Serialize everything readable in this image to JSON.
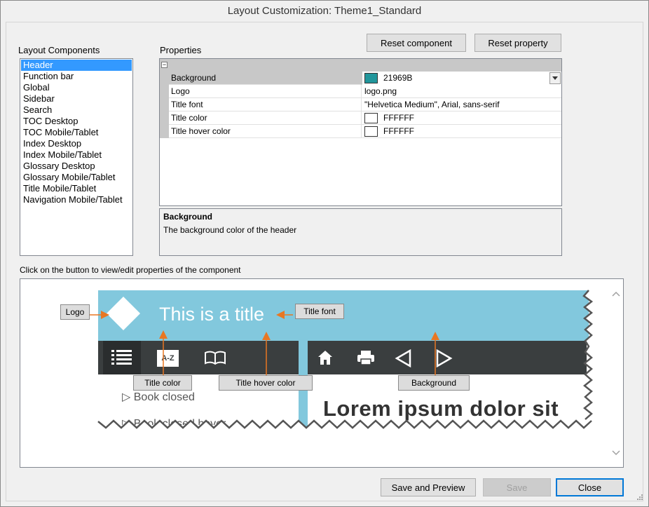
{
  "window": {
    "title": "Layout Customization: Theme1_Standard"
  },
  "components": {
    "label": "Layout Components",
    "items": [
      "Header",
      "Function bar",
      "Global",
      "Sidebar",
      "Search",
      "TOC Desktop",
      "TOC Mobile/Tablet",
      "Index Desktop",
      "Index Mobile/Tablet",
      "Glossary Desktop",
      "Glossary Mobile/Tablet",
      "Title Mobile/Tablet",
      "Navigation Mobile/Tablet"
    ],
    "selected": "Header"
  },
  "properties": {
    "label": "Properties",
    "reset_component": "Reset component",
    "reset_property": "Reset property",
    "rows": [
      {
        "name": "Background",
        "value": "21969B",
        "swatch": "#21969B"
      },
      {
        "name": "Logo",
        "value": "logo.png"
      },
      {
        "name": "Title font",
        "value": "\"Helvetica Medium\", Arial, sans-serif"
      },
      {
        "name": "Title color",
        "value": "FFFFFF",
        "swatch": "#FFFFFF"
      },
      {
        "name": "Title hover color",
        "value": "FFFFFF",
        "swatch": "#FFFFFF"
      }
    ],
    "description": {
      "title": "Background",
      "text": "The background color of the header"
    }
  },
  "preview": {
    "hint": "Click on the button to view/edit properties of the component",
    "title_text": "This is a title",
    "book_closed": "Book closed",
    "book_closed_hover": "Book closed hover",
    "lorem": "Lorem ipsum dolor sit",
    "toc_icon_label": "A-Z",
    "callouts": {
      "logo": "Logo",
      "title_font": "Title font",
      "title_color": "Title color",
      "title_hover_color": "Title hover color",
      "background": "Background"
    },
    "colors": {
      "header_bg": "#82C8DD",
      "toolbar_bg": "#3A3E3F",
      "arrow": "#E87722"
    }
  },
  "footer": {
    "save_preview": "Save and Preview",
    "save": "Save",
    "close": "Close"
  }
}
